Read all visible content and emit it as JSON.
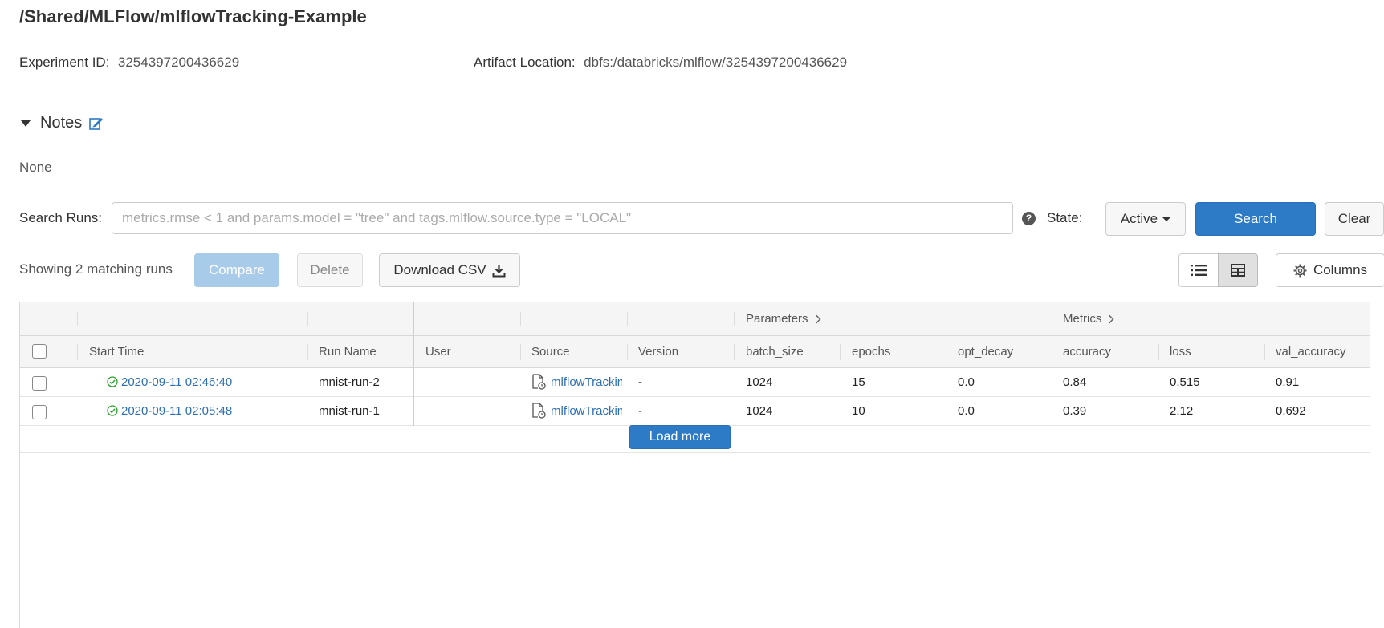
{
  "header": {
    "title": "/Shared/MLFlow/mlflowTracking-Example",
    "experiment_id_label": "Experiment ID:",
    "experiment_id": "3254397200436629",
    "artifact_location_label": "Artifact Location:",
    "artifact_location": "dbfs:/databricks/mlflow/3254397200436629"
  },
  "notes": {
    "label": "Notes",
    "content": "None"
  },
  "search": {
    "label": "Search Runs:",
    "placeholder": "metrics.rmse < 1 and params.model = \"tree\" and tags.mlflow.source.type = \"LOCAL\"",
    "value": "",
    "state_label": "State:",
    "state_value": "Active",
    "search_button": "Search",
    "clear_button": "Clear",
    "help_glyph": "?"
  },
  "toolbar": {
    "showing_text": "Showing 2 matching runs",
    "compare_button": "Compare",
    "delete_button": "Delete",
    "download_button": "Download CSV",
    "columns_button": "Columns"
  },
  "table": {
    "groups": {
      "parameters": "Parameters",
      "metrics": "Metrics"
    },
    "columns": [
      "Start Time",
      "Run Name",
      "User",
      "Source",
      "Version",
      "batch_size",
      "epochs",
      "opt_decay",
      "accuracy",
      "loss",
      "val_accuracy"
    ],
    "rows": [
      {
        "start_time": "2020-09-11 02:46:40",
        "run_name": "mnist-run-2",
        "user": "",
        "source": "mlflowTracking",
        "version": "-",
        "batch_size": "1024",
        "epochs": "15",
        "opt_decay": "0.0",
        "accuracy": "0.84",
        "loss": "0.515",
        "val_accuracy": "0.91"
      },
      {
        "start_time": "2020-09-11 02:05:48",
        "run_name": "mnist-run-1",
        "user": "",
        "source": "mlflowTracking",
        "version": "-",
        "batch_size": "1024",
        "epochs": "10",
        "opt_decay": "0.0",
        "accuracy": "0.39",
        "loss": "2.12",
        "val_accuracy": "0.692"
      }
    ],
    "load_more": "Load more"
  },
  "colors": {
    "primary": "#2d7bc6",
    "link": "#2d6fb0",
    "success": "#2ca02c"
  },
  "icons": {
    "notes_edit": "edit-icon",
    "help": "question-circle-icon",
    "download": "download-icon",
    "list_view": "list-view-icon",
    "table_view": "table-view-icon",
    "columns": "gear-icon",
    "status": "check-circle-icon",
    "source": "notebook-icon"
  }
}
